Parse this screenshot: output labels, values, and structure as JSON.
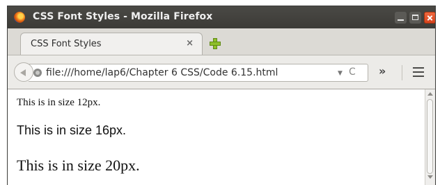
{
  "window": {
    "title": "CSS Font Styles - Mozilla Firefox"
  },
  "tabs": [
    {
      "label": "CSS Font Styles",
      "close_label": "×"
    }
  ],
  "toolbar": {
    "url": "file:///home/lap6/Chapter 6 CSS/Code 6.15.html",
    "dropdown_glyph": "▼",
    "reload_glyph": "C",
    "overflow_glyph": "»"
  },
  "content": {
    "lines": [
      "This is in size 12px.",
      "This is in size 16px.",
      "This is in size 20px."
    ]
  },
  "icons": {
    "app": "firefox-logo-icon",
    "new_tab": "plus-icon",
    "back": "back-arrow-icon",
    "site": "globe-icon",
    "menu": "hamburger-menu-icon"
  },
  "colors": {
    "titlebar": "#3c3b37",
    "close_button": "#e05a30",
    "new_tab_plus": "#8fbf2a"
  }
}
